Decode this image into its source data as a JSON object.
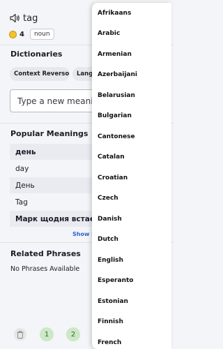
{
  "header": {
    "word": "tag",
    "coin_count": "4",
    "part_of_speech": "noun"
  },
  "dictionaries": {
    "title": "Dictionaries",
    "chips": [
      "Context Reverso",
      "Lange"
    ]
  },
  "new_meaning": {
    "placeholder": "Type a new meaning h"
  },
  "popular_meanings": {
    "title": "Popular Meanings",
    "items": [
      "день",
      "day",
      "День",
      "Tag",
      "Марк щодня встає"
    ],
    "show_more": "Show M"
  },
  "related_phrases": {
    "title": "Related Phrases",
    "empty_text": "No Phrases Available"
  },
  "pagination": {
    "pages": [
      "1",
      "2"
    ]
  },
  "language_dropdown": {
    "options": [
      "Afrikaans",
      "Arabic",
      "Armenian",
      "Azerbaijani",
      "Belarusian",
      "Bulgarian",
      "Cantonese",
      "Catalan",
      "Croatian",
      "Czech",
      "Danish",
      "Dutch",
      "English",
      "Esperanto",
      "Estonian",
      "Finnish",
      "French"
    ]
  },
  "colors": {
    "accent_link": "#2f60c9",
    "page_button_bg": "#cde8c6",
    "coin": "#f2c230"
  },
  "icons": {
    "speaker": "speaker-icon",
    "coin": "coin-icon",
    "flag": "uk-flag-icon",
    "trash": "trash-icon"
  }
}
